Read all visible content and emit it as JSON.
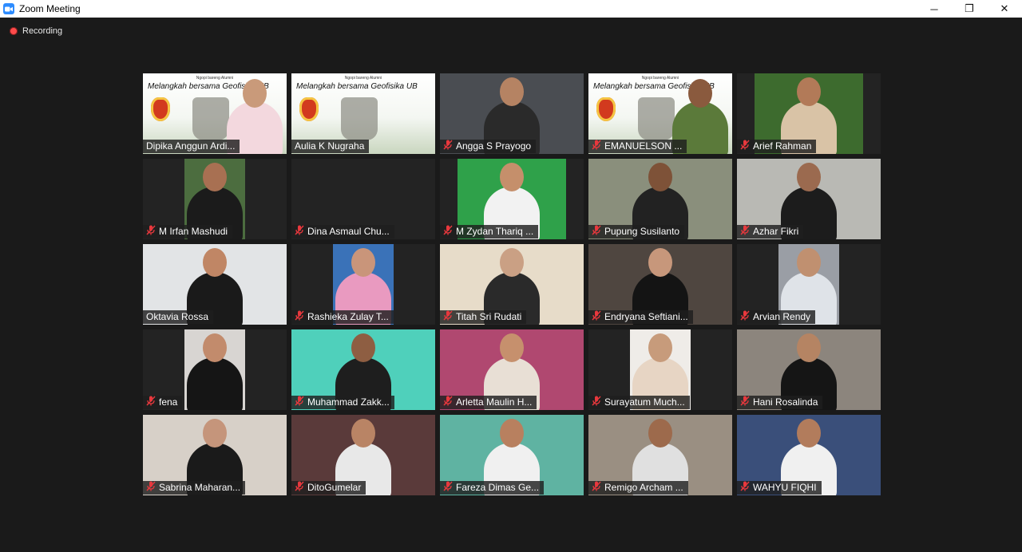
{
  "window": {
    "title": "Zoom Meeting",
    "icon": "zoom-camera-icon"
  },
  "controls": {
    "minimize": "─",
    "maximize": "❐",
    "close": "✕"
  },
  "recording": {
    "label": "Recording",
    "color": "#ff4b4b"
  },
  "colors": {
    "active_speaker": "#e5e562",
    "muted_icon": "#e8383d"
  },
  "participants": [
    {
      "name": "Dipika Anggun Ardi...",
      "muted": false,
      "video": "slide",
      "bg": "#cfd8c8",
      "skin": "#c99a7a",
      "cloth": "#f3d8de"
    },
    {
      "name": "Aulia K Nugraha",
      "muted": false,
      "video": "slide",
      "active": true,
      "bg": "#cfd8c8",
      "skin": "#c99a7a",
      "cloth": "#6a6a6a"
    },
    {
      "name": "Angga S Prayogo",
      "muted": true,
      "video": "full",
      "bg": "#4a4d52",
      "skin": "#b58363",
      "cloth": "#2a2a2a"
    },
    {
      "name": "EMANUELSON ...",
      "muted": true,
      "video": "slide",
      "bg": "#cfd8c8",
      "skin": "#8a5a3e",
      "cloth": "#5b7a3a"
    },
    {
      "name": "Arief Rahman",
      "muted": true,
      "video": "mid",
      "bg": "#3d6b2e",
      "skin": "#b27a58",
      "cloth": "#d9c3a6"
    },
    {
      "name": "M Irfan Mashudi",
      "muted": true,
      "video": "narrow",
      "bg": "#4c6d3f",
      "skin": "#a87052",
      "cloth": "#1b1b1b"
    },
    {
      "name": "Dina Asmaul Chu...",
      "muted": true,
      "video": "none"
    },
    {
      "name": "M Zydan Thariq ...",
      "muted": true,
      "video": "mid",
      "bg": "#2fa14a",
      "skin": "#c58f6b",
      "cloth": "#f2f2f2"
    },
    {
      "name": "Pupung Susilanto",
      "muted": true,
      "video": "full",
      "bg": "#8a8f7c",
      "skin": "#7e5238",
      "cloth": "#222222"
    },
    {
      "name": "Azhar Fikri",
      "muted": true,
      "video": "full",
      "bg": "#b9b9b4",
      "skin": "#9b6a4f",
      "cloth": "#1c1c1c"
    },
    {
      "name": "Oktavia Rossa",
      "muted": false,
      "video": "full",
      "bg": "#e2e4e6",
      "skin": "#c08665",
      "cloth": "#1a1a1a"
    },
    {
      "name": "Rashieka Zulay T...",
      "muted": true,
      "video": "narrow",
      "bg": "#3a72b8",
      "skin": "#c9957a",
      "cloth": "#e99ac0"
    },
    {
      "name": "Titah Sri Rudati",
      "muted": true,
      "video": "full",
      "bg": "#e7dcc9",
      "skin": "#caa084",
      "cloth": "#2a2a2a"
    },
    {
      "name": "Endryana Seftiani...",
      "muted": true,
      "video": "full",
      "bg": "#4f4640",
      "skin": "#c7977b",
      "cloth": "#141414"
    },
    {
      "name": "Arvian Rendy",
      "muted": true,
      "video": "narrow",
      "bg": "#9a9ea5",
      "skin": "#c09070",
      "cloth": "#dfe3e8"
    },
    {
      "name": "fena",
      "muted": true,
      "video": "narrow",
      "bg": "#d8d5d2",
      "skin": "#c28b6c",
      "cloth": "#151515"
    },
    {
      "name": "Muhammad Zakk...",
      "muted": true,
      "video": "full",
      "bg": "#4fd0bb",
      "skin": "#8e5e42",
      "cloth": "#1e1e1e"
    },
    {
      "name": "Arletta Maulin H...",
      "muted": true,
      "video": "full",
      "bg": "#b04870",
      "skin": "#c6906d",
      "cloth": "#e8dfd5"
    },
    {
      "name": "Surayatum Much...",
      "muted": true,
      "video": "narrow",
      "bg": "#efece8",
      "skin": "#c79b7b",
      "cloth": "#e7d5c4"
    },
    {
      "name": "Hani Rosalinda",
      "muted": true,
      "video": "full",
      "bg": "#8c857d",
      "skin": "#b58463",
      "cloth": "#151515"
    },
    {
      "name": "Sabrina Maharan...",
      "muted": true,
      "video": "full",
      "bg": "#d7d0c8",
      "skin": "#c5957b",
      "cloth": "#1a1a1a"
    },
    {
      "name": "DitoGumelar",
      "muted": true,
      "video": "full",
      "bg": "#5a3a3a",
      "skin": "#b98465",
      "cloth": "#e8e8e8"
    },
    {
      "name": "Fareza Dimas Ge...",
      "muted": true,
      "video": "full",
      "bg": "#5fb3a2",
      "skin": "#b8805f",
      "cloth": "#f0f0f0"
    },
    {
      "name": "Remigo Archam ...",
      "muted": true,
      "video": "full",
      "bg": "#9a8f82",
      "skin": "#9d6a4c",
      "cloth": "#e0e0e0"
    },
    {
      "name": "WAHYU FIQHI",
      "muted": true,
      "video": "full",
      "bg": "#3a4f7a",
      "skin": "#b27c5c",
      "cloth": "#f0f0f0"
    }
  ],
  "slide": {
    "small": "Ngopi bareng Alumni",
    "title": "Melangkah bersama Geofisika UB"
  }
}
